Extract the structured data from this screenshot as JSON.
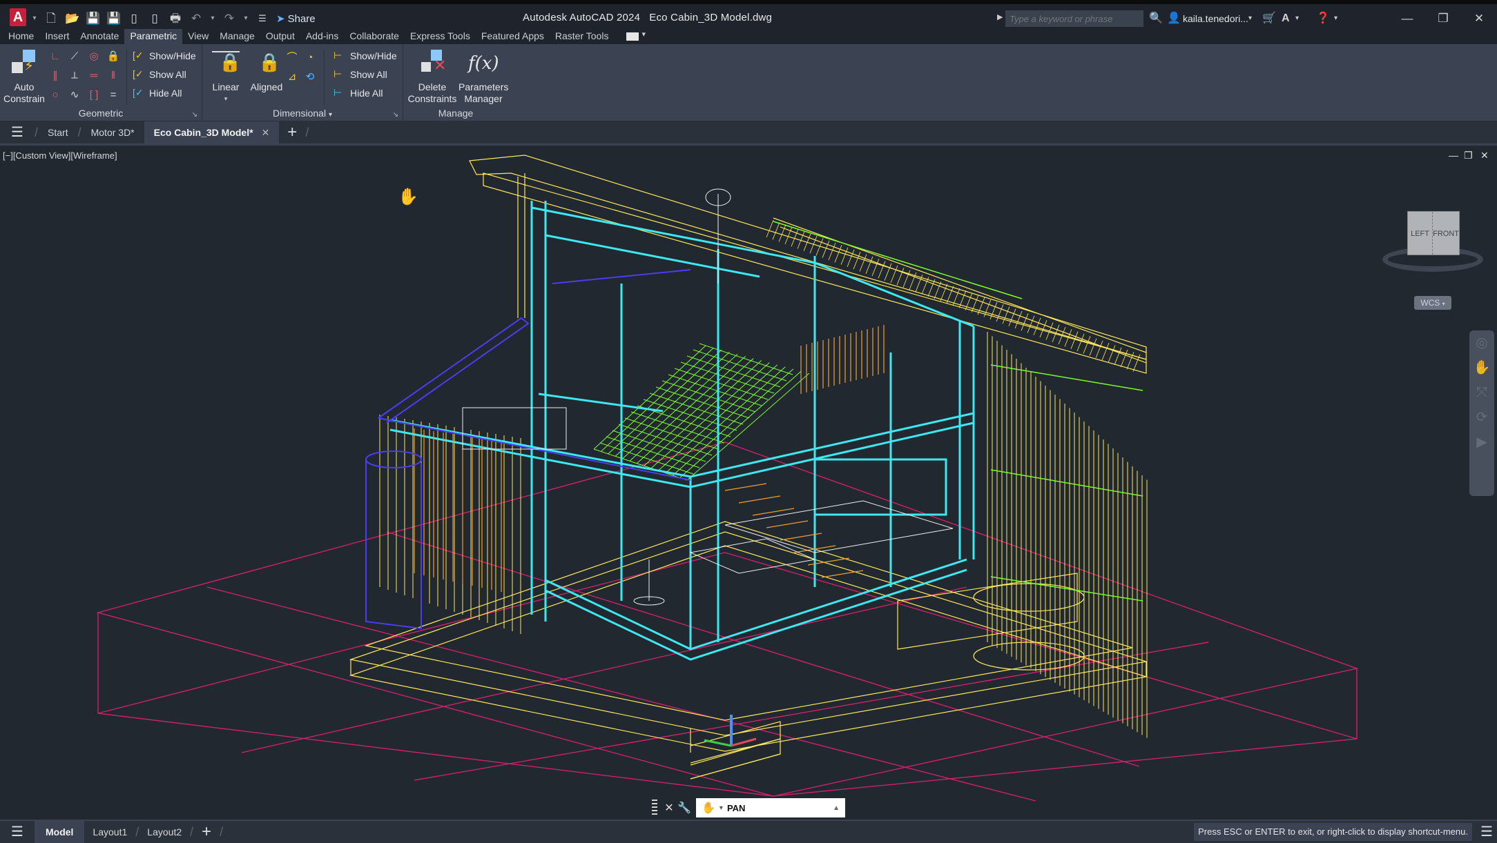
{
  "app": {
    "logo_letter": "A",
    "title": "Autodesk AutoCAD 2024   Eco Cabin_3D Model.dwg",
    "share_label": "Share",
    "search_placeholder": "Type a keyword or phrase",
    "user_name": "kaila.tenedori...",
    "quick_access_icons": [
      "new-icon",
      "open-icon",
      "save-icon",
      "save-as-icon",
      "open-from-mobile-icon",
      "save-to-mobile-icon",
      "plot-icon",
      "undo-icon",
      "redo-icon",
      "customize-icon"
    ]
  },
  "ribbon_tabs": [
    {
      "label": "Home"
    },
    {
      "label": "Insert"
    },
    {
      "label": "Annotate"
    },
    {
      "label": "Parametric",
      "active": true
    },
    {
      "label": "View"
    },
    {
      "label": "Manage"
    },
    {
      "label": "Output"
    },
    {
      "label": "Add-ins"
    },
    {
      "label": "Collaborate"
    },
    {
      "label": "Express Tools"
    },
    {
      "label": "Featured Apps"
    },
    {
      "label": "Raster Tools"
    }
  ],
  "ribbon": {
    "geometric": {
      "title": "Geometric",
      "auto_constrain": "Auto\nConstrain",
      "auto_constrain_l1": "Auto",
      "auto_constrain_l2": "Constrain",
      "show_hide": "Show/Hide",
      "show_all": "Show All",
      "hide_all": "Hide All",
      "constraint_icons": [
        "coincident-icon",
        "collinear-icon",
        "concentric-icon",
        "fix-icon",
        "parallel-icon",
        "perpendicular-icon",
        "horizontal-icon",
        "vertical-icon",
        "tangent-icon",
        "smooth-icon",
        "symmetric-icon",
        "equal-icon"
      ]
    },
    "dimensional": {
      "title": "Dimensional",
      "linear": "Linear",
      "aligned": "Aligned",
      "show_hide": "Show/Hide",
      "show_all": "Show All",
      "hide_all": "Hide All"
    },
    "manage": {
      "title": "Manage",
      "delete_l1": "Delete",
      "delete_l2": "Constraints",
      "params_l1": "Parameters",
      "params_l2": "Manager",
      "fx": "f(x)"
    }
  },
  "file_tabs": [
    {
      "label": "Start"
    },
    {
      "label": "Motor 3D*"
    },
    {
      "label": "Eco Cabin_3D Model*",
      "active": true
    }
  ],
  "viewport": {
    "label": "[−][Custom View][Wireframe]",
    "viewcube_left": "LEFT",
    "viewcube_front": "FRONT",
    "wcs": "WCS",
    "colors": {
      "background": "#212830",
      "yellow": "#ffe95a",
      "cyan": "#3ee8f0",
      "green": "#7cff2a",
      "orange": "#f0a030",
      "blue": "#4a3ef0",
      "magenta": "#d0206a",
      "white": "#f0f0f0"
    }
  },
  "command_line": {
    "value": "PAN"
  },
  "layout_tabs": [
    {
      "label": "Model",
      "active": true
    },
    {
      "label": "Layout1"
    },
    {
      "label": "Layout2"
    }
  ],
  "status": {
    "message": "Press ESC or ENTER to exit, or right-click to display shortcut-menu."
  }
}
